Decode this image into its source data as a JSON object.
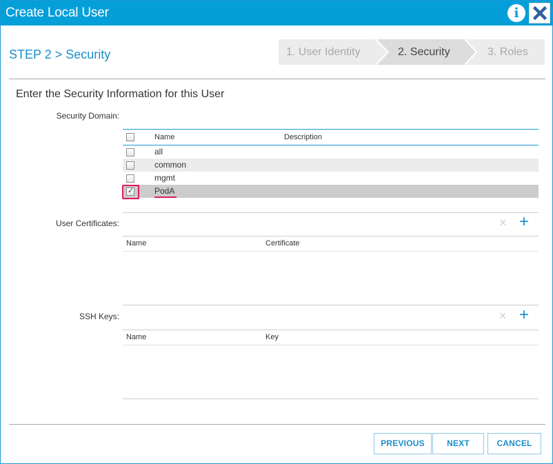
{
  "dialog": {
    "title": "Create Local User"
  },
  "header": {
    "step_title": "STEP 2 > Security"
  },
  "wizard": {
    "steps": [
      {
        "label": "1. User Identity",
        "state": "inactive"
      },
      {
        "label": "2. Security",
        "state": "active"
      },
      {
        "label": "3. Roles",
        "state": "inactive"
      }
    ]
  },
  "form": {
    "heading": "Enter the Security Information for this User",
    "security_domain": {
      "label": "Security Domain:",
      "columns": {
        "name": "Name",
        "description": "Description"
      },
      "rows": [
        {
          "name": "all",
          "checked": false
        },
        {
          "name": "common",
          "checked": false
        },
        {
          "name": "mgmt",
          "checked": false
        },
        {
          "name": "PodA",
          "checked": true
        }
      ]
    },
    "user_certificates": {
      "label": "User Certificates:",
      "columns": {
        "name": "Name",
        "certificate": "Certificate"
      },
      "remove_icon": "×",
      "add_icon": "+"
    },
    "ssh_keys": {
      "label": "SSH Keys:",
      "columns": {
        "name": "Name",
        "key": "Key"
      },
      "remove_icon": "×",
      "add_icon": "+"
    }
  },
  "footer": {
    "previous_label": "PREVIOUS",
    "next_label": "NEXT",
    "cancel_label": "CANCEL"
  },
  "colors": {
    "titlebar": "#049fd9",
    "accent": "#1a8fc9",
    "highlight": "#e0195f"
  },
  "icons": {
    "info": "i",
    "close": "x-icon"
  }
}
